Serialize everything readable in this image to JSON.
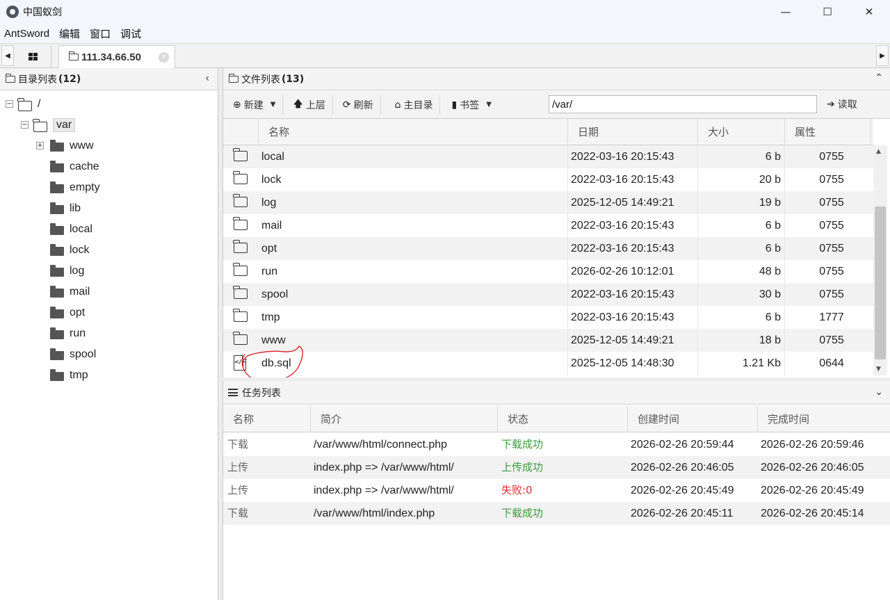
{
  "window": {
    "title": "中国蚁剑",
    "minimize": "—",
    "maximize": "☐",
    "close": "✕"
  },
  "menu": [
    "AntSword",
    "编辑",
    "窗口",
    "调试"
  ],
  "tabs": {
    "active_label": "111.34.66.50",
    "prev_arrow": "◀",
    "next_arrow": "▶",
    "close_glyph": "✕"
  },
  "directory_panel": {
    "title": "目录列表",
    "count": "(12)",
    "collapse_glyph": "‹",
    "root": "/",
    "current": "var",
    "children": [
      "www",
      "cache",
      "empty",
      "lib",
      "local",
      "lock",
      "log",
      "mail",
      "opt",
      "run",
      "spool",
      "tmp"
    ]
  },
  "file_panel": {
    "title": "文件列表",
    "count": "(13)",
    "collapse_glyph": "⌃",
    "toolbar": {
      "new": "新建",
      "up": "上层",
      "refresh": "刷新",
      "home": "主目录",
      "bookmark": "书签",
      "path_value": "/var/",
      "read": "读取"
    },
    "columns": [
      "名称",
      "日期",
      "大小",
      "属性"
    ],
    "rows": [
      {
        "name": "local",
        "date": "2022-03-16 20:15:43",
        "size": "6 b",
        "attr": "0755",
        "type": "folder"
      },
      {
        "name": "lock",
        "date": "2022-03-16 20:15:43",
        "size": "20 b",
        "attr": "0755",
        "type": "folder"
      },
      {
        "name": "log",
        "date": "2025-12-05 14:49:21",
        "size": "19 b",
        "attr": "0755",
        "type": "folder"
      },
      {
        "name": "mail",
        "date": "2022-03-16 20:15:43",
        "size": "6 b",
        "attr": "0755",
        "type": "folder"
      },
      {
        "name": "opt",
        "date": "2022-03-16 20:15:43",
        "size": "6 b",
        "attr": "0755",
        "type": "folder"
      },
      {
        "name": "run",
        "date": "2026-02-26 10:12:01",
        "size": "48 b",
        "attr": "0755",
        "type": "folder"
      },
      {
        "name": "spool",
        "date": "2022-03-16 20:15:43",
        "size": "30 b",
        "attr": "0755",
        "type": "folder"
      },
      {
        "name": "tmp",
        "date": "2022-03-16 20:15:43",
        "size": "6 b",
        "attr": "1777",
        "type": "folder"
      },
      {
        "name": "www",
        "date": "2025-12-05 14:49:21",
        "size": "18 b",
        "attr": "0755",
        "type": "folder"
      },
      {
        "name": "db.sql",
        "date": "2025-12-05 14:48:30",
        "size": "1.21 Kb",
        "attr": "0644",
        "type": "file"
      }
    ]
  },
  "task_panel": {
    "title": "任务列表",
    "collapse_glyph": "⌄",
    "columns": [
      "名称",
      "简介",
      "状态",
      "创建时间",
      "完成时间"
    ],
    "rows": [
      {
        "type": "下载",
        "desc": "/var/www/html/connect.php",
        "status": "下载成功",
        "status_kind": "ok",
        "created": "2026-02-26 20:59:44",
        "done": "2026-02-26 20:59:46"
      },
      {
        "type": "上传",
        "desc": "index.php => /var/www/html/",
        "status": "上传成功",
        "status_kind": "ok",
        "created": "2026-02-26 20:46:05",
        "done": "2026-02-26 20:46:05"
      },
      {
        "type": "上传",
        "desc": "index.php => /var/www/html/",
        "status": "失败:0",
        "status_kind": "fail",
        "created": "2026-02-26 20:45:49",
        "done": "2026-02-26 20:45:49"
      },
      {
        "type": "下载",
        "desc": "/var/www/html/index.php",
        "status": "下载成功",
        "status_kind": "ok",
        "created": "2026-02-26 20:45:11",
        "done": "2026-02-26 20:45:14"
      }
    ]
  },
  "colors": {
    "success": "#3c9a3c",
    "failure": "#e03030",
    "annotation": "#d9262b"
  }
}
